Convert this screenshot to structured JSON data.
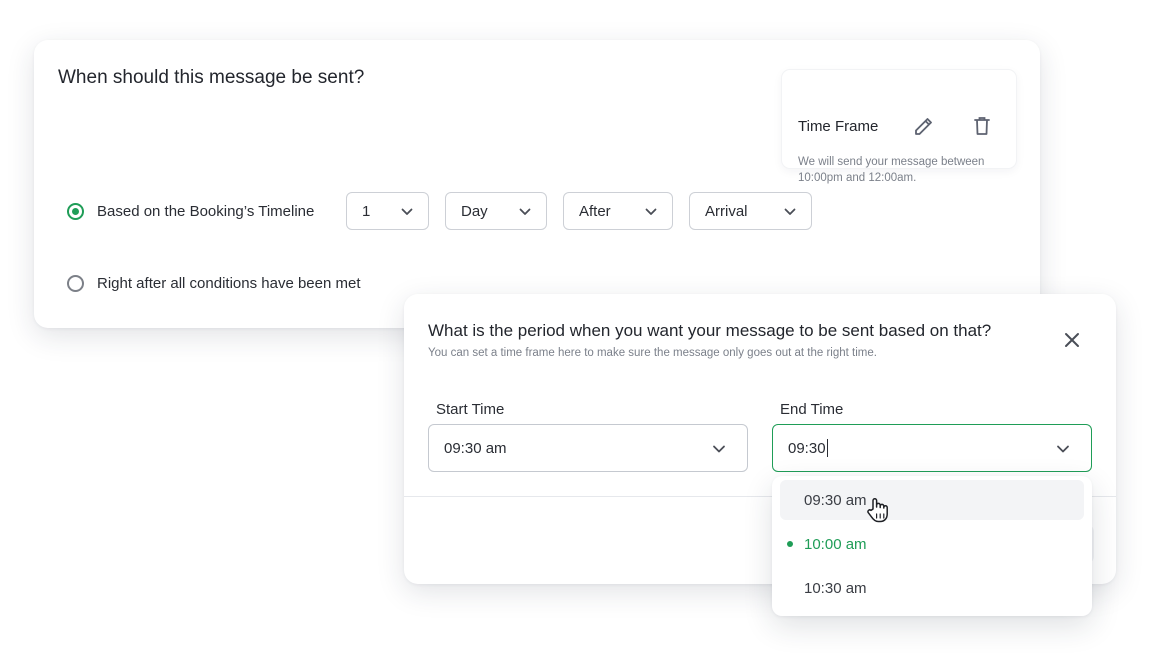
{
  "main": {
    "title": "When should this message be sent?",
    "time_frame": {
      "title": "Time Frame",
      "description": "We will send your message between 10:00pm and 12:00am.",
      "edit_icon": "pencil-icon",
      "delete_icon": "trash-icon"
    },
    "options": [
      {
        "label": "Based on the Booking’s Timeline",
        "selected": true
      },
      {
        "label": "Right after all conditions have been met",
        "selected": false
      }
    ],
    "selects": {
      "number": "1",
      "unit": "Day",
      "relation": "After",
      "event": "Arrival"
    }
  },
  "modal": {
    "title": "What is the period when you want your message to be sent based on that?",
    "subtitle": "You can set a time frame here to make sure the message only goes out at the right time.",
    "start_label": "Start Time",
    "start_value": "09:30 am",
    "end_label": "End Time",
    "end_value": "09:30",
    "close_icon": "close-icon"
  },
  "dropdown": {
    "options": [
      {
        "label": "09:30 am",
        "hovered": true
      },
      {
        "label": "10:00 am",
        "selected": true
      },
      {
        "label": "10:30 am"
      }
    ]
  },
  "colors": {
    "accent": "#1f9d57",
    "text": "#2a2d34",
    "muted": "#7b808a",
    "border": "#cdd0d6"
  }
}
